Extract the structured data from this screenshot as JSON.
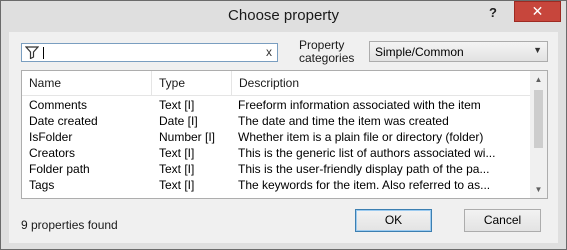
{
  "window": {
    "title": "Choose property",
    "help_label": "?",
    "close_label": "✕"
  },
  "filter": {
    "value": "",
    "clear_label": "x"
  },
  "categories": {
    "label_line1": "Property",
    "label_line2": "categories",
    "selected": "Simple/Common"
  },
  "columns": [
    "Name",
    "Type",
    "Description"
  ],
  "rows": [
    {
      "name": "Comments",
      "type": "Text [I]",
      "description": "Freeform information associated with the item"
    },
    {
      "name": "Date created",
      "type": "Date [I]",
      "description": "The date and time the item was created"
    },
    {
      "name": "IsFolder",
      "type": "Number [I]",
      "description": "Whether item is a plain file or directory (folder)"
    },
    {
      "name": "Creators",
      "type": "Text [I]",
      "description": "This is the generic list of authors associated wi..."
    },
    {
      "name": "Folder path",
      "type": "Text [I]",
      "description": "This is the user-friendly display path of the pa..."
    },
    {
      "name": "Tags",
      "type": "Text [I]",
      "description": "The keywords for the item. Also referred to as..."
    }
  ],
  "status": "9 properties found",
  "buttons": {
    "ok": "OK",
    "cancel": "Cancel"
  },
  "colors": {
    "close_button": "#c7463c",
    "focus_border": "#3c7fb1"
  }
}
